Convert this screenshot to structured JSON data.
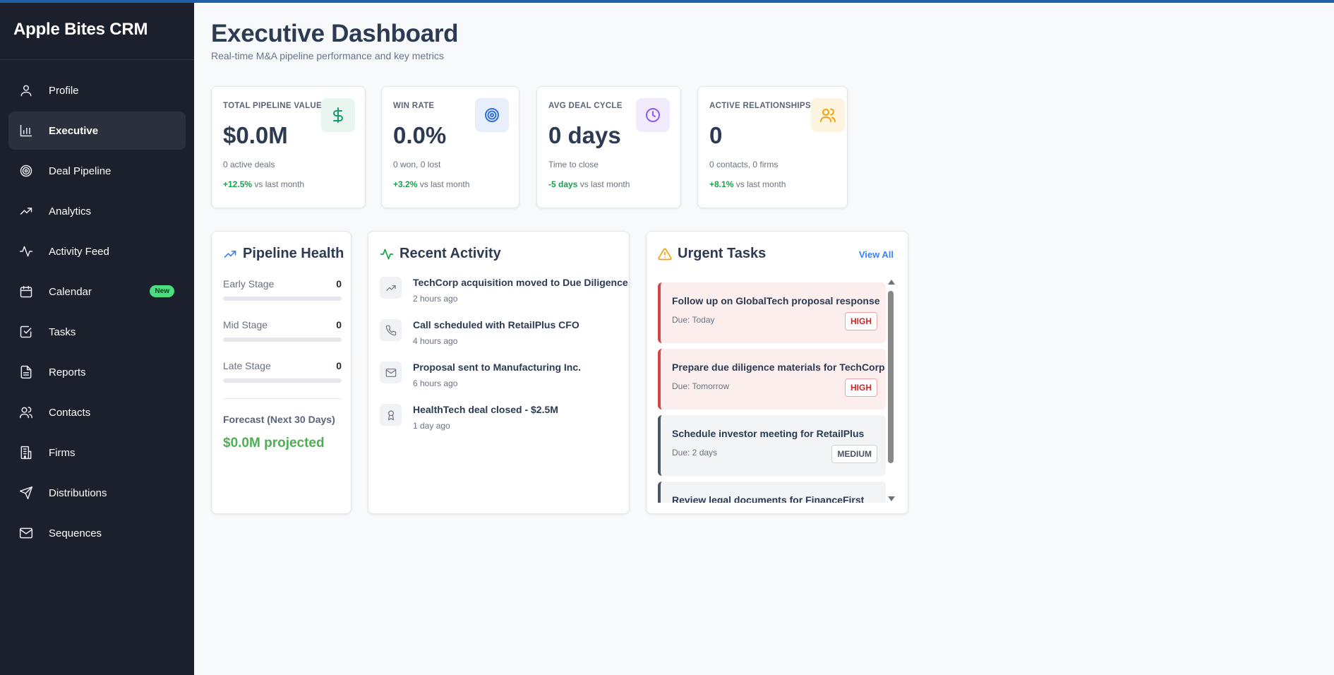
{
  "app": {
    "brand": "Apple Bites CRM"
  },
  "sidebar": {
    "items": [
      {
        "label": "Profile",
        "icon": "user-icon"
      },
      {
        "label": "Executive",
        "icon": "bar-chart-icon",
        "active": true
      },
      {
        "label": "Deal Pipeline",
        "icon": "target-icon"
      },
      {
        "label": "Analytics",
        "icon": "trending-up-icon"
      },
      {
        "label": "Activity Feed",
        "icon": "activity-icon"
      },
      {
        "label": "Calendar",
        "icon": "calendar-icon",
        "badge": "New"
      },
      {
        "label": "Tasks",
        "icon": "check-square-icon"
      },
      {
        "label": "Reports",
        "icon": "file-text-icon"
      },
      {
        "label": "Contacts",
        "icon": "users-icon"
      },
      {
        "label": "Firms",
        "icon": "building-icon"
      },
      {
        "label": "Distributions",
        "icon": "send-icon"
      },
      {
        "label": "Sequences",
        "icon": "mail-icon"
      }
    ]
  },
  "header": {
    "title": "Executive Dashboard",
    "subtitle": "Real-time M&A pipeline performance and key metrics"
  },
  "metrics": [
    {
      "label": "TOTAL PIPELINE VALUE",
      "value": "$0.0M",
      "sub": "0 active deals",
      "delta": "+12.5%",
      "trend_text": "vs last month",
      "icon": "dollar-icon",
      "color": "#1a9a6a"
    },
    {
      "label": "WIN RATE",
      "value": "0.0%",
      "sub": "0 won, 0 lost",
      "delta": "+3.2%",
      "trend_text": "vs last month",
      "icon": "target-icon",
      "color": "#2f6fdc"
    },
    {
      "label": "AVG DEAL CYCLE",
      "value": "0 days",
      "sub": "Time to close",
      "delta": "-5 days",
      "trend_text": "vs last month",
      "icon": "clock-icon",
      "color": "#8b5cf6"
    },
    {
      "label": "ACTIVE RELATIONSHIPS",
      "value": "0",
      "sub": "0 contacts, 0 firms",
      "delta": "+8.1%",
      "trend_text": "vs last month",
      "icon": "users-icon",
      "color": "#f59e0b"
    }
  ],
  "pipeline_health": {
    "title": "Pipeline Health",
    "stages": [
      {
        "label": "Early Stage",
        "count": "0",
        "fill": 0
      },
      {
        "label": "Mid Stage",
        "count": "0",
        "fill": 0
      },
      {
        "label": "Late Stage",
        "count": "0",
        "fill": 0
      }
    ],
    "forecast_label": "Forecast (Next 30 Days)",
    "forecast_value": "$0.0M projected"
  },
  "recent_activity": {
    "title": "Recent Activity",
    "items": [
      {
        "text": "TechCorp acquisition moved to Due Diligence",
        "time": "2 hours ago",
        "icon": "trending-up-icon"
      },
      {
        "text": "Call scheduled with RetailPlus CFO",
        "time": "4 hours ago",
        "icon": "phone-icon"
      },
      {
        "text": "Proposal sent to Manufacturing Inc.",
        "time": "6 hours ago",
        "icon": "mail-icon"
      },
      {
        "text": "HealthTech deal closed - $2.5M",
        "time": "1 day ago",
        "icon": "award-icon"
      }
    ]
  },
  "urgent_tasks": {
    "title": "Urgent Tasks",
    "view_all": "View All",
    "items": [
      {
        "title": "Follow up on GlobalTech proposal response",
        "due": "Due: Today",
        "priority": "HIGH"
      },
      {
        "title": "Prepare due diligence materials for TechCorp",
        "due": "Due: Tomorrow",
        "priority": "HIGH"
      },
      {
        "title": "Schedule investor meeting for RetailPlus",
        "due": "Due: 2 days",
        "priority": "MEDIUM"
      },
      {
        "title": "Review legal documents for FinanceFirst",
        "due": "",
        "priority": ""
      }
    ]
  }
}
